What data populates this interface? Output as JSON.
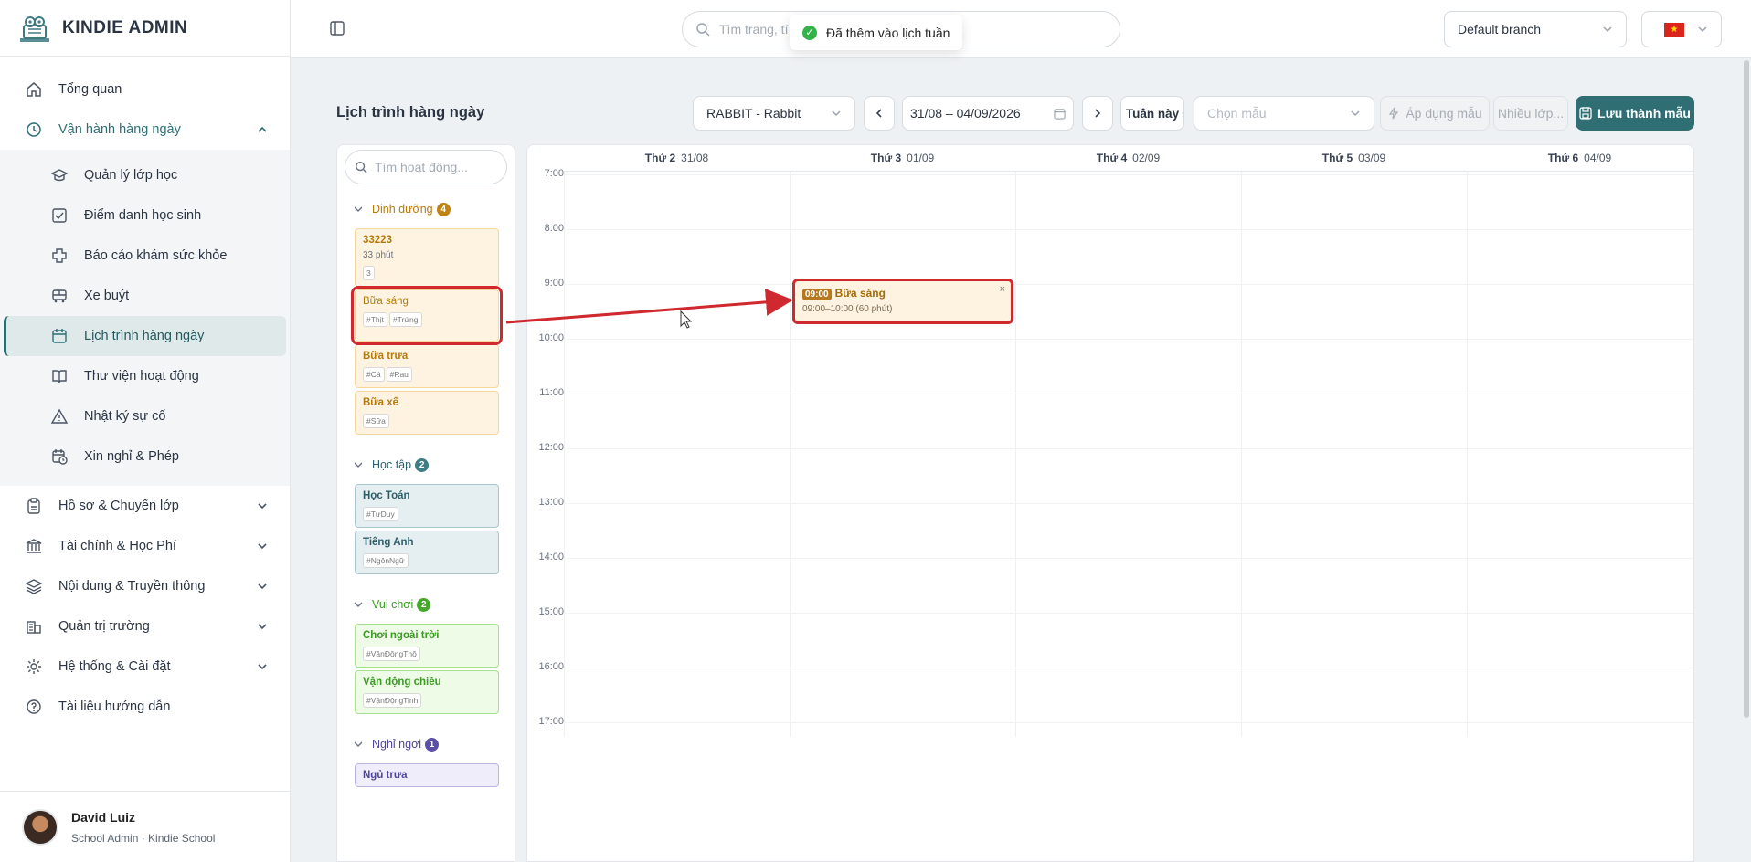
{
  "app": {
    "title": "KINDIE ADMIN"
  },
  "sidebar": {
    "items": [
      {
        "label": "Tổng quan",
        "icon": "home-icon"
      },
      {
        "label": "Vận hành hàng ngày",
        "icon": "clock-icon",
        "expanded": true,
        "children": [
          {
            "label": "Quản lý lớp học",
            "icon": "graduation-cap-icon"
          },
          {
            "label": "Điểm danh học sinh",
            "icon": "check-square-icon"
          },
          {
            "label": "Báo cáo khám sức khỏe",
            "icon": "health-cross-icon"
          },
          {
            "label": "Xe buýt",
            "icon": "bus-icon"
          },
          {
            "label": "Lịch trình hàng ngày",
            "icon": "calendar-icon",
            "active": true
          },
          {
            "label": "Thư viện hoạt động",
            "icon": "book-icon"
          },
          {
            "label": "Nhật ký sự cố",
            "icon": "warning-icon"
          },
          {
            "label": "Xin nghỉ & Phép",
            "icon": "calendar-clock-icon"
          }
        ]
      },
      {
        "label": "Hồ sơ & Chuyển lớp",
        "icon": "clipboard-icon"
      },
      {
        "label": "Tài chính & Học Phí",
        "icon": "bank-icon"
      },
      {
        "label": "Nội dung & Truyền thông",
        "icon": "layers-icon"
      },
      {
        "label": "Quản trị trường",
        "icon": "building-icon"
      },
      {
        "label": "Hệ thống & Cài đặt",
        "icon": "gear-icon"
      },
      {
        "label": "Tài liệu hướng dẫn",
        "icon": "help-circle-icon"
      }
    ]
  },
  "user": {
    "name": "David Luiz",
    "role": "School Admin · Kindie School"
  },
  "topbar": {
    "search_placeholder": "Tìm trang, tí",
    "toast": "Đã thêm vào lịch tuần",
    "branch": "Default branch",
    "language_flag": "vietnam-flag-icon"
  },
  "page": {
    "title": "Lịch trình hàng ngày",
    "class_select": "RABBIT - Rabbit",
    "date_range": "31/08 – 04/09/2026",
    "this_week": "Tuần này",
    "template_placeholder": "Chọn mẫu",
    "apply_template": "Áp dụng mẫu",
    "multi_class": "Nhiều lớp...",
    "save_template": "Lưu thành mẫu"
  },
  "palette": {
    "search_placeholder": "Tìm hoạt động...",
    "groups": [
      {
        "name": "Dinh dưỡng",
        "count": "4",
        "color": "#b67a0c",
        "badge": "#c08412",
        "cards": [
          {
            "title": "33223",
            "desc": "33 phút",
            "tags": [
              "3"
            ]
          },
          {
            "title": "Bữa sáng",
            "desc": "",
            "tags": [
              "#Thịt",
              "#Trứng"
            ]
          },
          {
            "title": "Bữa trưa",
            "desc": "",
            "tags": [
              "#Cá",
              "#Rau"
            ]
          },
          {
            "title": "Bữa xế",
            "desc": "",
            "tags": [
              "#Sữa"
            ]
          }
        ]
      },
      {
        "name": "Học tập",
        "count": "2",
        "color": "#2c5f6a",
        "badge": "#3e7c86",
        "cards": [
          {
            "title": "Học Toán",
            "desc": "",
            "tags": [
              "#TưDuy"
            ]
          },
          {
            "title": "Tiếng Anh",
            "desc": "",
            "tags": [
              "#NgônNgữ"
            ]
          }
        ]
      },
      {
        "name": "Vui chơi",
        "count": "2",
        "color": "#3c9b25",
        "badge": "#46a82c",
        "cards": [
          {
            "title": "Chơi ngoài trời",
            "desc": "",
            "tags": [
              "#VậnĐộngThô"
            ]
          },
          {
            "title": "Vận động chiều",
            "desc": "",
            "tags": [
              "#VậnĐộngTinh"
            ]
          }
        ]
      },
      {
        "name": "Nghỉ ngơi",
        "count": "1",
        "color": "#4f4599",
        "badge": "#5b50a8",
        "cards": [
          {
            "title": "Ngủ trưa",
            "desc": "",
            "tags": []
          }
        ]
      }
    ]
  },
  "calendar": {
    "days": [
      {
        "name": "Thứ 2",
        "date": "31/08"
      },
      {
        "name": "Thứ 3",
        "date": "01/09"
      },
      {
        "name": "Thứ 4",
        "date": "02/09"
      },
      {
        "name": "Thứ 5",
        "date": "03/09"
      },
      {
        "name": "Thứ 6",
        "date": "04/09"
      }
    ],
    "hours": [
      "7:00",
      "8:00",
      "9:00",
      "10:00",
      "11:00",
      "12:00",
      "13:00",
      "14:00",
      "15:00",
      "16:00",
      "17:00"
    ],
    "event": {
      "time": "09:00",
      "name": "Bữa sáng",
      "range": "09:00–10:00 (60 phút)",
      "close": "×"
    }
  }
}
